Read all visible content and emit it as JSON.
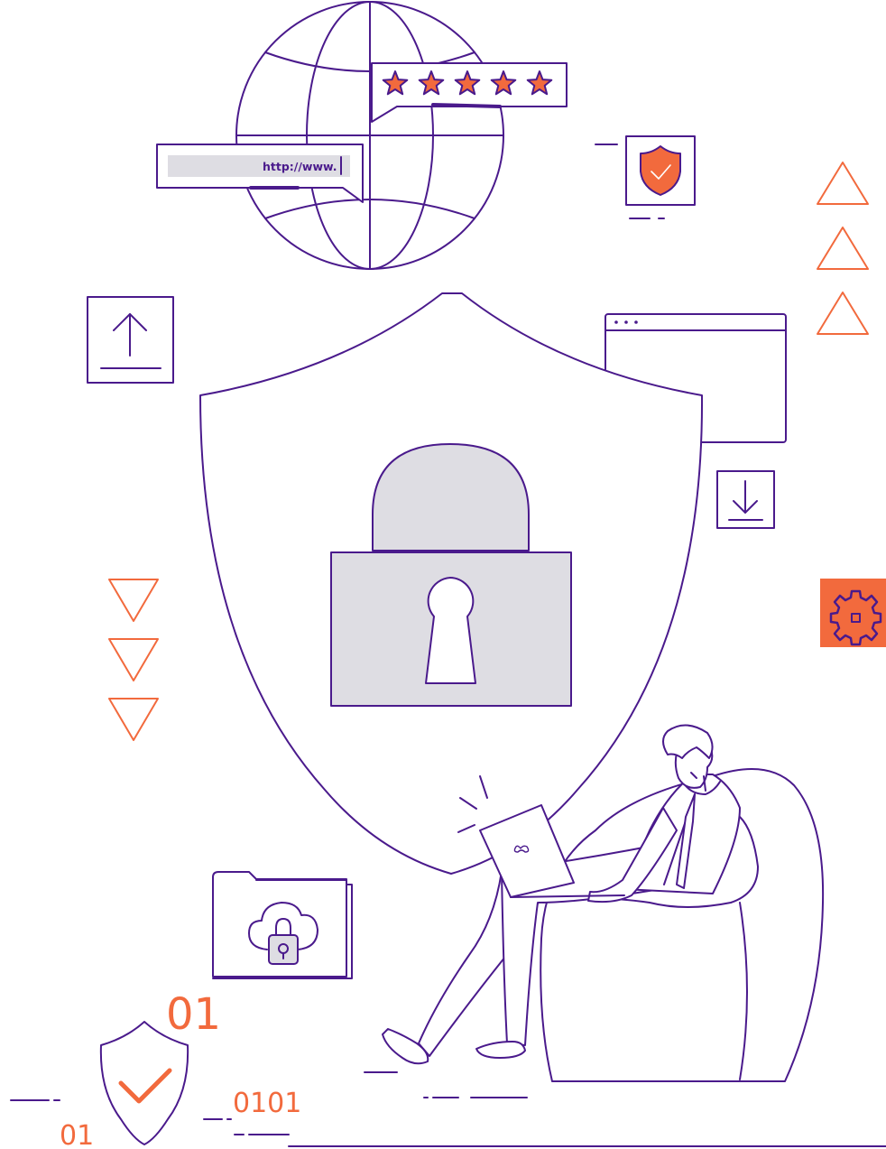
{
  "colors": {
    "primary": "#4a1a8c",
    "accent": "#f26a3d",
    "fill_gray": "#dedde3",
    "background": "#ffffff"
  },
  "url_bar": {
    "text": "http://www."
  },
  "rating": {
    "stars": 5,
    "max": 5
  },
  "binary": {
    "top_large": "01",
    "right": "0101",
    "left": "01"
  },
  "icons": [
    "globe-icon",
    "star-icon",
    "shield-check-icon",
    "upload-icon",
    "browser-window-icon",
    "download-icon",
    "shield-icon",
    "padlock-icon",
    "keyhole-icon",
    "gear-icon",
    "cloud-lock-folder-icon",
    "triangle-up-icon",
    "triangle-down-icon",
    "laptop-icon",
    "checkmark-icon"
  ]
}
